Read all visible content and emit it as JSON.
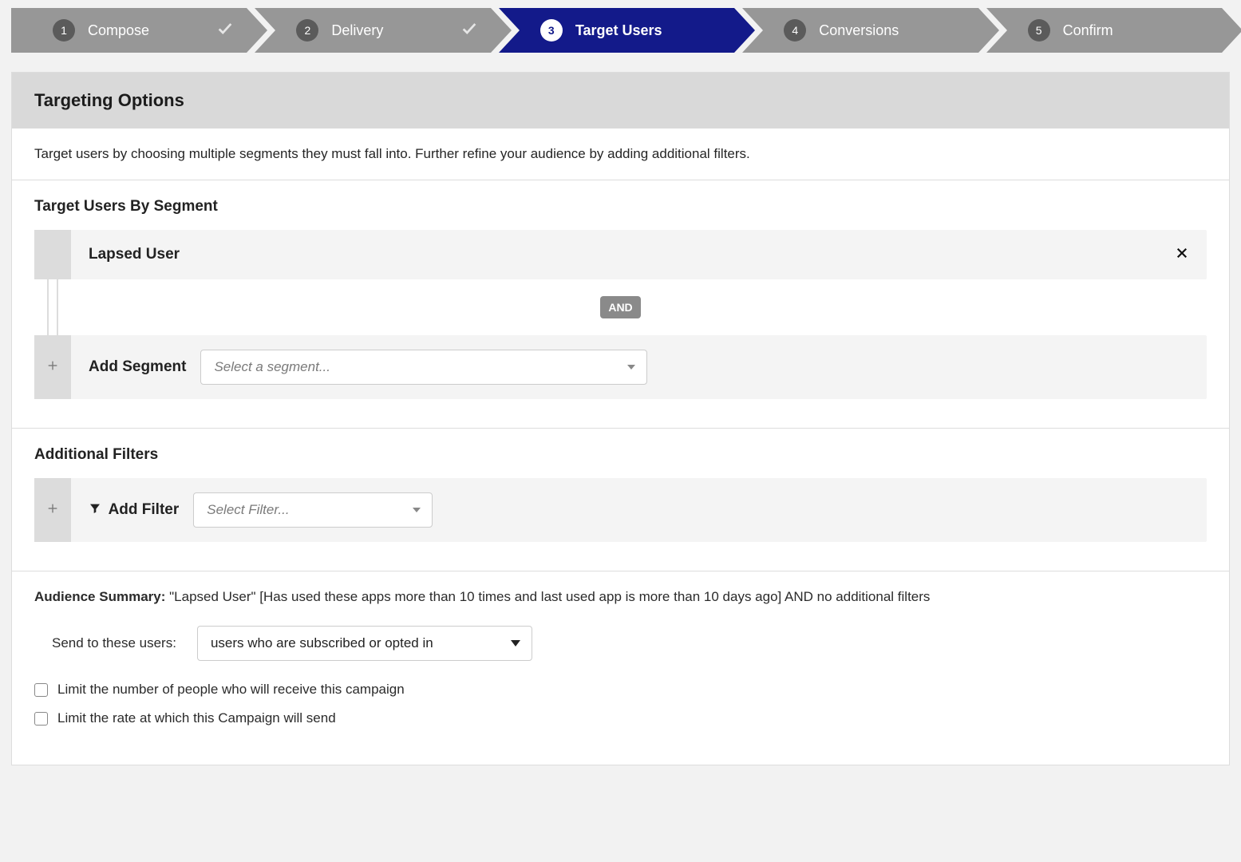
{
  "stepper": {
    "steps": [
      {
        "num": "1",
        "label": "Compose",
        "done": true
      },
      {
        "num": "2",
        "label": "Delivery",
        "done": true
      },
      {
        "num": "3",
        "label": "Target Users",
        "active": true
      },
      {
        "num": "4",
        "label": "Conversions"
      },
      {
        "num": "5",
        "label": "Confirm"
      }
    ]
  },
  "panel": {
    "title": "Targeting Options",
    "description": "Target users by choosing multiple segments they must fall into. Further refine your audience by adding additional filters."
  },
  "segments": {
    "heading": "Target Users By Segment",
    "selected": [
      {
        "name": "Lapsed User"
      }
    ],
    "joiner": "AND",
    "add_label": "Add Segment",
    "select_placeholder": "Select a segment..."
  },
  "filters": {
    "heading": "Additional Filters",
    "add_label": "Add Filter",
    "select_placeholder": "Select Filter..."
  },
  "summary": {
    "label": "Audience Summary:",
    "text": "\"Lapsed User\" [Has used these apps more than 10 times and last used app is more than 10 days ago] AND no additional filters",
    "send_to_label": "Send to these users:",
    "send_to_value": "users who are subscribed or opted in",
    "limit_people": "Limit the number of people who will receive this campaign",
    "limit_rate": "Limit the rate at which this Campaign will send"
  }
}
